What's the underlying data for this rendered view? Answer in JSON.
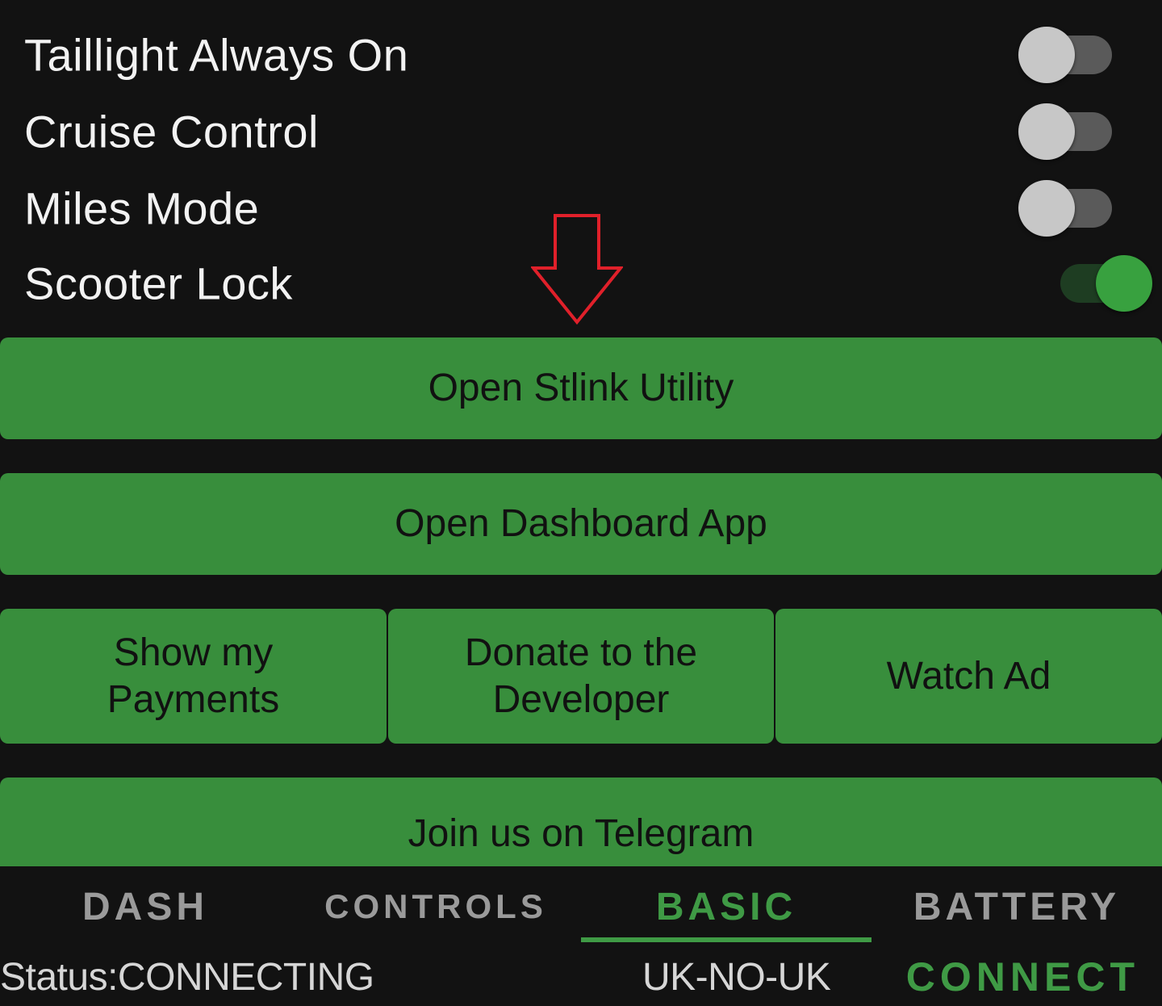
{
  "settings": [
    {
      "label": "Taillight Always On",
      "enabled": false
    },
    {
      "label": "Cruise Control",
      "enabled": false
    },
    {
      "label": "Miles Mode",
      "enabled": false
    },
    {
      "label": "Scooter Lock",
      "enabled": true
    }
  ],
  "buttons": {
    "open_stlink": "Open Stlink Utility",
    "open_dashboard": "Open Dashboard App",
    "show_payments": "Show my Payments",
    "donate": "Donate to the Developer",
    "watch_ad": "Watch Ad",
    "telegram": "Join us on Telegram"
  },
  "tabs": [
    {
      "label": "DASH",
      "active": false
    },
    {
      "label": "CONTROLS",
      "active": false
    },
    {
      "label": "BASIC",
      "active": true
    },
    {
      "label": "BATTERY",
      "active": false
    }
  ],
  "status": {
    "text": "Status:CONNECTING",
    "region": "UK-NO-UK",
    "connect_label": "CONNECT"
  },
  "colors": {
    "background": "#121212",
    "button_green": "#388e3c",
    "accent_green": "#3f9a45",
    "annotation_red": "#e0202a"
  },
  "icons": {
    "annotation": "red-arrow-down-icon"
  }
}
